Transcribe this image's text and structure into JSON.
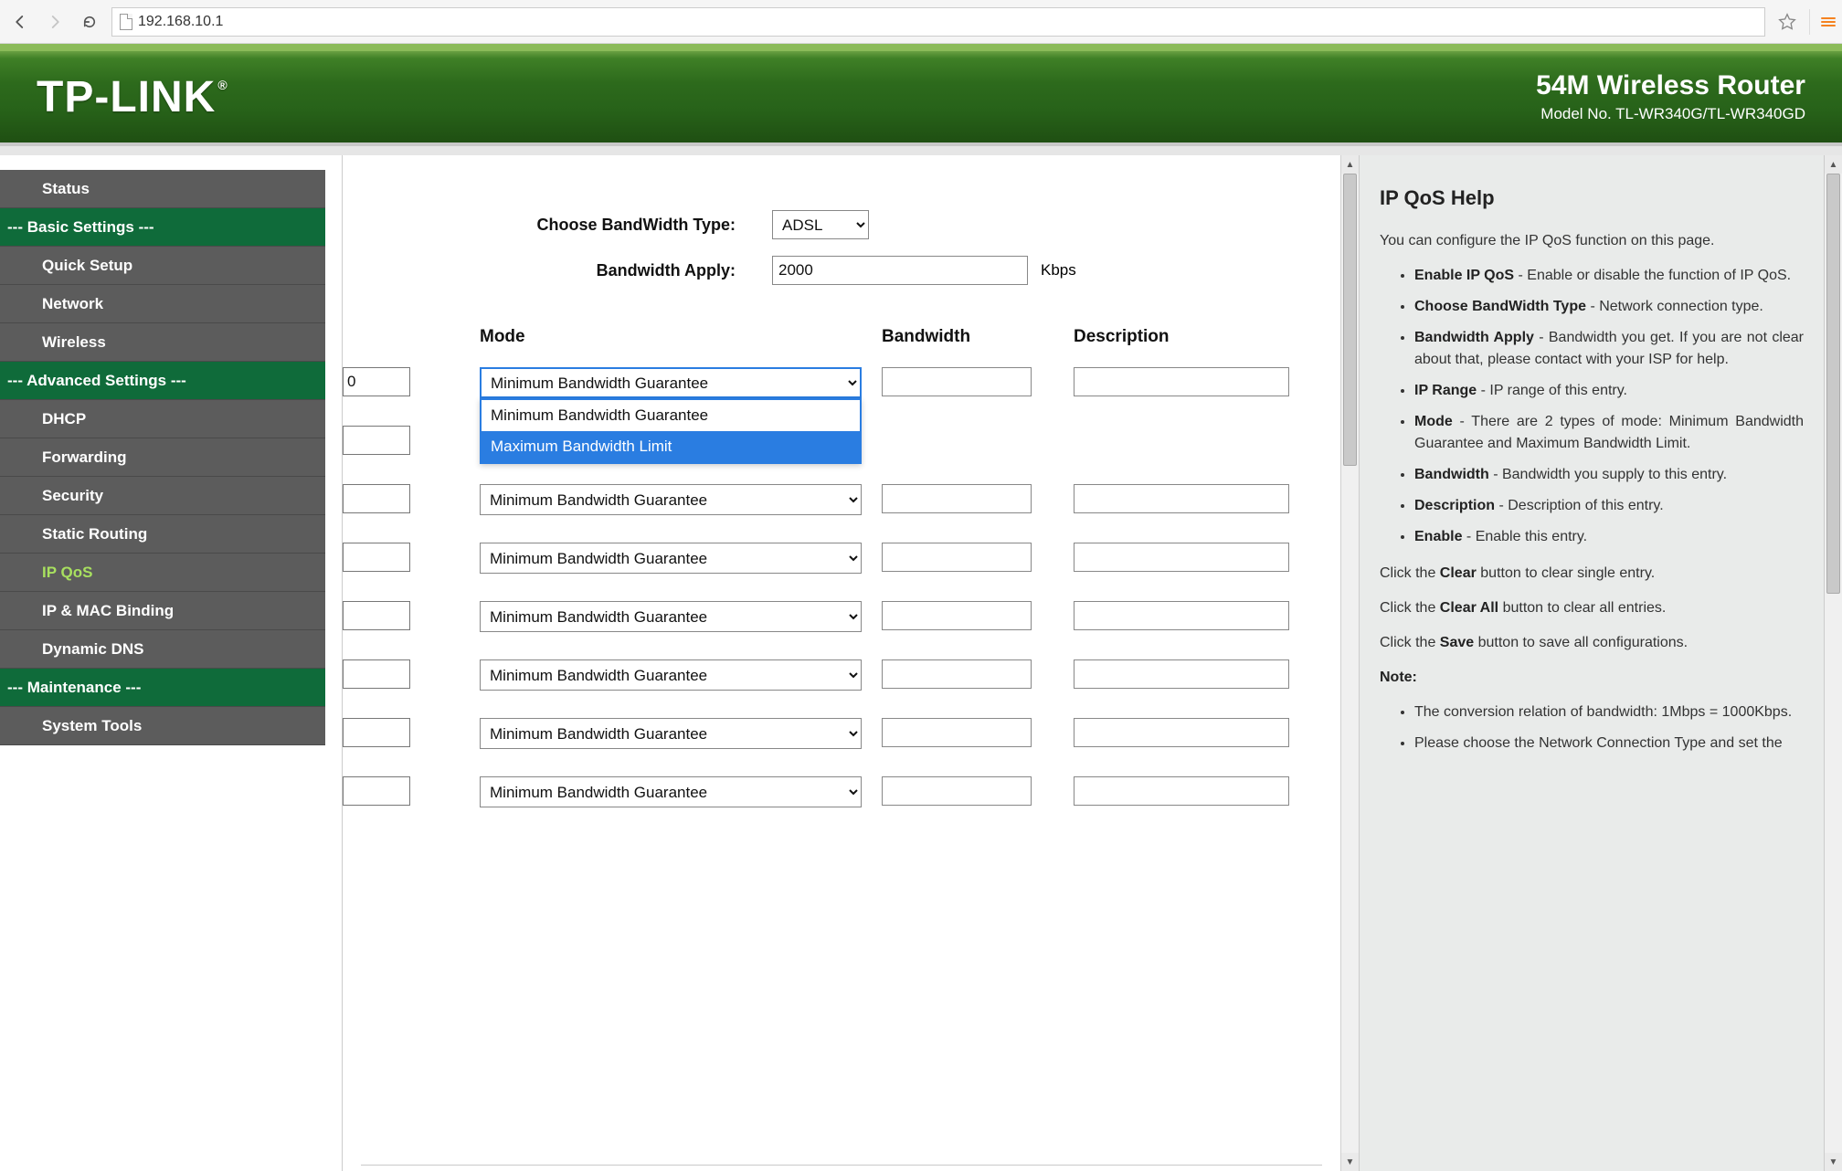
{
  "browser": {
    "address": "192.168.10.1"
  },
  "banner": {
    "brand": "TP-LINK",
    "reg": "®",
    "title": "54M Wireless Router",
    "model": "Model No. TL-WR340G/TL-WR340GD"
  },
  "sidebar": {
    "items": [
      {
        "label": "Status",
        "type": "item"
      },
      {
        "label": "--- Basic Settings ---",
        "type": "header"
      },
      {
        "label": "Quick Setup",
        "type": "item"
      },
      {
        "label": "Network",
        "type": "item"
      },
      {
        "label": "Wireless",
        "type": "item"
      },
      {
        "label": "--- Advanced Settings ---",
        "type": "header"
      },
      {
        "label": "DHCP",
        "type": "item"
      },
      {
        "label": "Forwarding",
        "type": "item"
      },
      {
        "label": "Security",
        "type": "item"
      },
      {
        "label": "Static Routing",
        "type": "item"
      },
      {
        "label": "IP QoS",
        "type": "item",
        "active": true
      },
      {
        "label": "IP & MAC Binding",
        "type": "item"
      },
      {
        "label": "Dynamic DNS",
        "type": "item"
      },
      {
        "label": "--- Maintenance ---",
        "type": "header"
      },
      {
        "label": "System Tools",
        "type": "item"
      }
    ]
  },
  "form": {
    "bw_type_label": "Choose BandWidth Type:",
    "bw_type_value": "ADSL",
    "bw_apply_label": "Bandwidth Apply:",
    "bw_apply_value": "2000",
    "bw_apply_unit": "Kbps"
  },
  "table": {
    "headers": {
      "mode": "Mode",
      "bandwidth": "Bandwidth",
      "description": "Description"
    },
    "mode_option": "Minimum Bandwidth Guarantee",
    "dropdown_options": [
      "Minimum Bandwidth Guarantee",
      "Maximum Bandwidth Limit"
    ],
    "rows": [
      {
        "range": "0",
        "mode": "Minimum Bandwidth Guarantee",
        "open": true,
        "bandwidth": "",
        "description": ""
      },
      {
        "range": "",
        "mode": "",
        "bandwidth": "",
        "description": ""
      },
      {
        "range": "",
        "mode": "Minimum Bandwidth Guarantee",
        "bandwidth": "",
        "description": ""
      },
      {
        "range": "",
        "mode": "Minimum Bandwidth Guarantee",
        "bandwidth": "",
        "description": ""
      },
      {
        "range": "",
        "mode": "Minimum Bandwidth Guarantee",
        "bandwidth": "",
        "description": ""
      },
      {
        "range": "",
        "mode": "Minimum Bandwidth Guarantee",
        "bandwidth": "",
        "description": ""
      },
      {
        "range": "",
        "mode": "Minimum Bandwidth Guarantee",
        "bandwidth": "",
        "description": ""
      },
      {
        "range": "",
        "mode": "Minimum Bandwidth Guarantee",
        "bandwidth": "",
        "description": ""
      }
    ]
  },
  "help": {
    "title": "IP QoS Help",
    "intro": "You can configure the IP QoS function on this page.",
    "bullets": [
      {
        "b": "Enable IP QoS",
        "t": " - Enable or disable the function of IP QoS."
      },
      {
        "b": "Choose BandWidth Type",
        "t": " - Network connection type."
      },
      {
        "b": "Bandwidth Apply",
        "t": " - Bandwidth you get. If you are not clear about that, please contact with your ISP for help."
      },
      {
        "b": "IP Range",
        "t": " - IP range of this entry."
      },
      {
        "b": "Mode",
        "t": " - There are 2 types of mode: Minimum Bandwidth Guarantee and Maximum Bandwidth Limit."
      },
      {
        "b": "Bandwidth",
        "t": " - Bandwidth you supply to this entry."
      },
      {
        "b": "Description",
        "t": " - Description of this entry."
      },
      {
        "b": "Enable",
        "t": " - Enable this entry."
      }
    ],
    "p_clear_pre": "Click the ",
    "p_clear_b": "Clear",
    "p_clear_post": " button to clear single entry.",
    "p_clearall_pre": "Click the ",
    "p_clearall_b": "Clear All",
    "p_clearall_post": " button to clear all entries.",
    "p_save_pre": "Click the ",
    "p_save_b": "Save",
    "p_save_post": " button to save all configurations.",
    "note_label": "Note:",
    "notes": [
      "The conversion relation of bandwidth: 1Mbps = 1000Kbps.",
      "Please choose the Network Connection Type and set the"
    ]
  }
}
